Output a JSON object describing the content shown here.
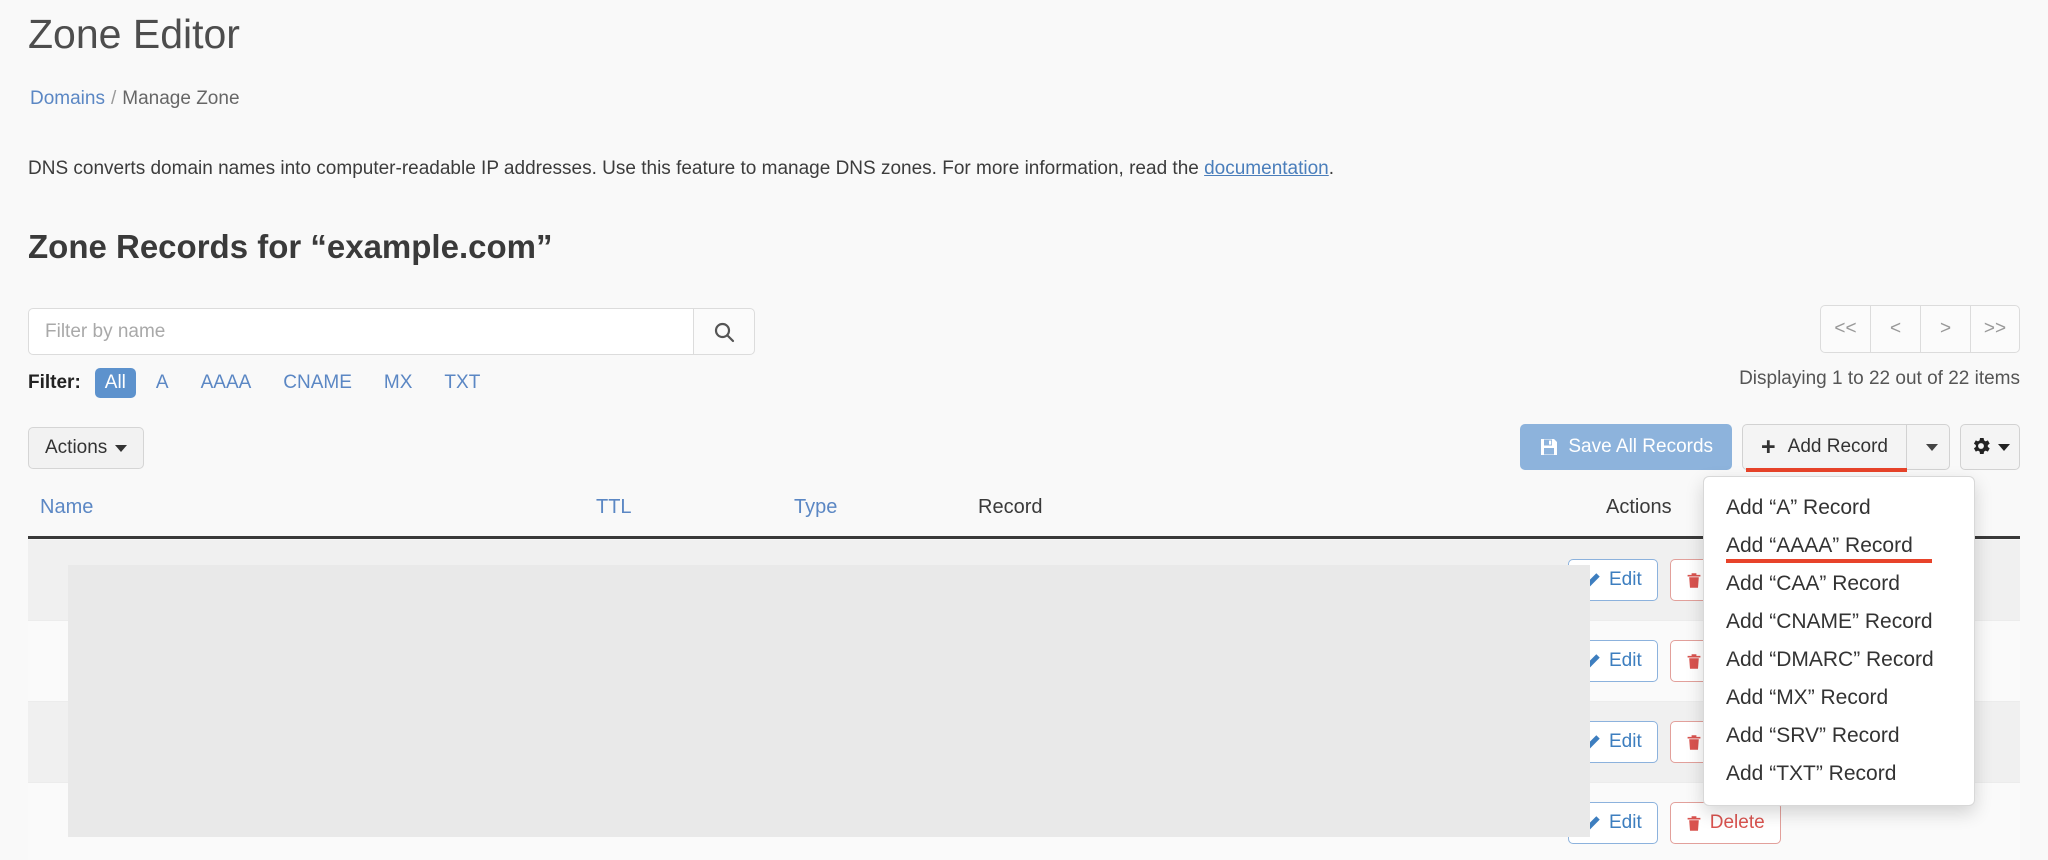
{
  "header": {
    "title": "Zone Editor",
    "breadcrumb": {
      "root": "Domains",
      "separator": "/",
      "current": "Manage Zone"
    },
    "intro_before": "DNS converts domain names into computer-readable IP addresses. Use this feature to manage DNS zones. For more information, read the ",
    "intro_link": "documentation",
    "intro_after": "."
  },
  "section": {
    "title": "Zone Records for “example.com”"
  },
  "search": {
    "placeholder": "Filter by name",
    "value": "",
    "icon": "search-icon"
  },
  "filter": {
    "label": "Filter:",
    "options": [
      {
        "label": "All",
        "active": true
      },
      {
        "label": "A",
        "active": false
      },
      {
        "label": "AAAA",
        "active": false
      },
      {
        "label": "CNAME",
        "active": false
      },
      {
        "label": "MX",
        "active": false
      },
      {
        "label": "TXT",
        "active": false
      }
    ]
  },
  "pagination": {
    "first": "<<",
    "prev": "<",
    "next": ">",
    "last": ">>",
    "count_text": "Displaying 1 to 22 out of 22 items"
  },
  "toolbar": {
    "actions_label": "Actions",
    "save_label": "Save All Records",
    "add_label": "Add Record",
    "add_plus": "+",
    "gear_icon": "gear-icon",
    "caret_icon": "chevron-down-icon"
  },
  "add_record_menu": {
    "open": true,
    "items": [
      {
        "label": "Add “A” Record",
        "highlighted": false
      },
      {
        "label": "Add “AAAA” Record",
        "highlighted": true
      },
      {
        "label": "Add “CAA” Record",
        "highlighted": false
      },
      {
        "label": "Add “CNAME” Record",
        "highlighted": false
      },
      {
        "label": "Add “DMARC” Record",
        "highlighted": false
      },
      {
        "label": "Add “MX” Record",
        "highlighted": false
      },
      {
        "label": "Add “SRV” Record",
        "highlighted": false
      },
      {
        "label": "Add “TXT” Record",
        "highlighted": false
      }
    ]
  },
  "table": {
    "columns": [
      {
        "label": "Name",
        "sortable": true
      },
      {
        "label": "TTL",
        "sortable": true
      },
      {
        "label": "Type",
        "sortable": true
      },
      {
        "label": "Record",
        "sortable": false
      },
      {
        "label": "Actions",
        "sortable": false
      }
    ],
    "row_actions": {
      "edit": "Edit",
      "delete": "Delete"
    },
    "rows": [
      {
        "name": "",
        "ttl": "",
        "type": "",
        "record": ""
      },
      {
        "name": "",
        "ttl": "",
        "type": "",
        "record": ""
      },
      {
        "name": "",
        "ttl": "",
        "type": "",
        "record": ""
      },
      {
        "name": "",
        "ttl": "",
        "type": "",
        "record": ""
      }
    ]
  },
  "colors": {
    "link": "#5b87c4",
    "accent_blue": "#5d92cd",
    "save_blue": "#8db3dc",
    "highlight_red": "#e8432a",
    "delete_red": "#d9534f",
    "page_bg": "#f9f9f9"
  }
}
